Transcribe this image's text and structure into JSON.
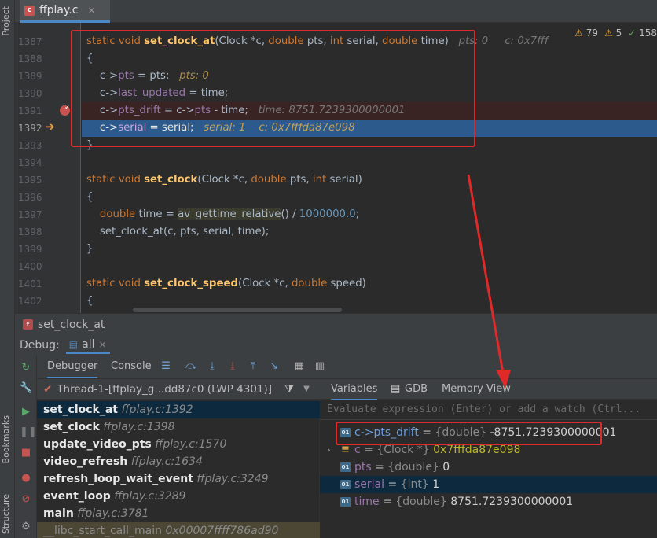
{
  "left_strip": {
    "project_label": "Project",
    "bookmarks_label": "Bookmarks",
    "structure_label": "Structure"
  },
  "editor_tab": {
    "label": "ffplay.c",
    "icon": "c-file-icon",
    "close": "×"
  },
  "inspections": {
    "warnings": "79",
    "weak_warnings": "5",
    "ok": "158"
  },
  "lines": [
    {
      "num": "1387"
    },
    {
      "num": "1388"
    },
    {
      "num": "1389"
    },
    {
      "num": "1390"
    },
    {
      "num": "1391"
    },
    {
      "num": "1392"
    },
    {
      "num": "1393"
    },
    {
      "num": "1394"
    },
    {
      "num": "1395"
    },
    {
      "num": "1396"
    },
    {
      "num": "1397"
    },
    {
      "num": "1398"
    },
    {
      "num": "1399"
    },
    {
      "num": "1400"
    },
    {
      "num": "1401"
    },
    {
      "num": "1402"
    }
  ],
  "code": {
    "l1387": {
      "kw1": "static",
      "kw2": "void",
      "fn": "set_clock_at",
      "p1": "(Clock *c, ",
      "kw3": "double",
      "p2": " pts, ",
      "kw4": "int",
      "p3": " serial, ",
      "kw5": "double",
      "p4": " time)",
      "hint": "pts: 0     c: 0x7fff"
    },
    "l1388": {
      "text": "{"
    },
    "l1389": {
      "a": "c->",
      "f": "pts",
      "b": " = pts;",
      "hint": "pts: 0"
    },
    "l1390": {
      "a": "c->",
      "f": "last_updated",
      "b": " = time;"
    },
    "l1391": {
      "a": "c->",
      "f": "pts_drift",
      "b": " = c->",
      "f2": "pts",
      "c": " - time;",
      "hint": "time: 8751.7239300000001"
    },
    "l1392": {
      "a": "c->",
      "f": "serial",
      "b": " = serial;",
      "hint": "serial: 1    c: 0x7fffda87e098"
    },
    "l1393": {
      "text": "}"
    },
    "l1395": {
      "kw1": "static",
      "kw2": "void",
      "fn": "set_clock",
      "p1": "(Clock *c, ",
      "kw3": "double",
      "p2": " pts, ",
      "kw4": "int",
      "p3": " serial)"
    },
    "l1396": {
      "text": "{"
    },
    "l1397": {
      "kw": "double",
      "a": " time = ",
      "call": "av_gettime_relative",
      "b": "() / ",
      "num": "1000000.0",
      "c": ";"
    },
    "l1398": {
      "text": "set_clock_at(c, pts, serial, time);"
    },
    "l1399": {
      "text": "}"
    },
    "l1401": {
      "kw1": "static",
      "kw2": "void",
      "fn": "set_clock_speed",
      "p1": "(Clock *c, ",
      "kw3": "double",
      "p2": " speed)"
    },
    "l1402": {
      "text": "{"
    }
  },
  "breadcrumb": {
    "icon": "function-icon",
    "label": "set_clock_at"
  },
  "debug": {
    "label": "Debug:",
    "config": "all",
    "close": "×"
  },
  "debug_tabs": {
    "debugger": "Debugger",
    "console": "Console"
  },
  "thread": {
    "label": "Thread-1-[ffplay_g...dd87c0 (LWP 4301)]"
  },
  "frames": [
    {
      "name": "set_clock_at",
      "loc": "ffplay.c:1392"
    },
    {
      "name": "set_clock",
      "loc": "ffplay.c:1398"
    },
    {
      "name": "update_video_pts",
      "loc": "ffplay.c:1570"
    },
    {
      "name": "video_refresh",
      "loc": "ffplay.c:1634"
    },
    {
      "name": "refresh_loop_wait_event",
      "loc": "ffplay.c:3249"
    },
    {
      "name": "event_loop",
      "loc": "ffplay.c:3289"
    },
    {
      "name": "main",
      "loc": "ffplay.c:3781"
    },
    {
      "name": "__libc_start_call_main",
      "loc": "0x00007ffff786ad90"
    }
  ],
  "var_tabs": {
    "variables": "Variables",
    "gdb": "GDB",
    "memory": "Memory View"
  },
  "eval_placeholder": "Evaluate expression (Enter) or add a watch (Ctrl...",
  "variables": [
    {
      "name": "c->pts_drift",
      "eq": " = ",
      "type": "{double}",
      "value": " -8751.7239300000001"
    },
    {
      "name": "c",
      "eq": " = ",
      "type": "{Clock *}",
      "value": " 0x7fffda87e098"
    },
    {
      "name": "pts",
      "eq": " = ",
      "type": "{double}",
      "value": " 0"
    },
    {
      "name": "serial",
      "eq": " = ",
      "type": "{int}",
      "value": " 1"
    },
    {
      "name": "time",
      "eq": " = ",
      "type": "{double}",
      "value": " 8751.7239300000001"
    }
  ],
  "colors": {
    "annotation": "#e02a2a",
    "current_line": "#2d5a8c",
    "breakpoint_line": "#3a2323"
  }
}
